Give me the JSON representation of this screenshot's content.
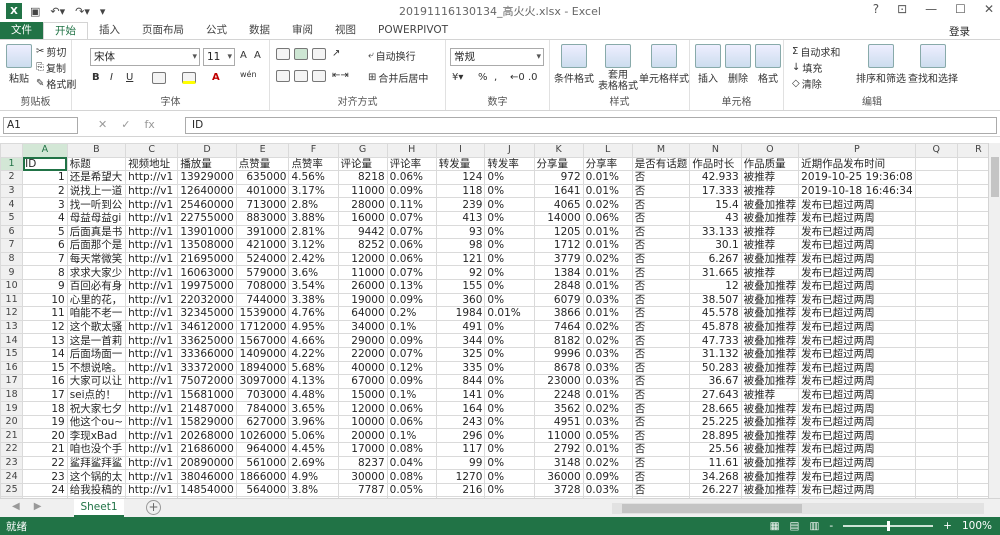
{
  "window": {
    "title": "20191116130134_高火火.xlsx - Excel",
    "app_badge": "X",
    "minimize": "?",
    "restore": "☐",
    "close": "✕",
    "help": "?"
  },
  "tabs": [
    "文件",
    "开始",
    "插入",
    "页面布局",
    "公式",
    "数据",
    "审阅",
    "视图",
    "POWERPIVOT"
  ],
  "login": "登录",
  "ribbon": {
    "clipboard": {
      "label": "剪贴板",
      "paste": "粘贴",
      "cut": "剪切",
      "copy": "复制",
      "format_painter": "格式刷"
    },
    "font": {
      "label": "字体",
      "name": "宋体",
      "size": "11",
      "bold": "B",
      "italic": "I",
      "underline": "U",
      "grow": "A",
      "shrink": "A",
      "wen": "wén"
    },
    "alignment": {
      "label": "对齐方式",
      "wrap": "自动换行",
      "merge": "合并后居中"
    },
    "number": {
      "label": "数字",
      "format": "常规",
      "percent": "%",
      "comma": ","
    },
    "styles": {
      "label": "样式",
      "conditional": "条件格式",
      "table": "套用\n表格格式",
      "cell": "单元格样式"
    },
    "cells": {
      "label": "单元格",
      "insert": "插入",
      "delete": "删除",
      "format": "格式"
    },
    "editing": {
      "label": "编辑",
      "autosum": "自动求和",
      "fill": "填充",
      "clear": "清除",
      "sort": "排序和筛选",
      "find": "查找和选择"
    }
  },
  "formula_bar": {
    "name_box": "A1",
    "fx": "fx",
    "value": "ID"
  },
  "columns": [
    "A",
    "B",
    "C",
    "D",
    "E",
    "F",
    "G",
    "H",
    "I",
    "J",
    "K",
    "L",
    "M",
    "N",
    "O",
    "P",
    "Q",
    "R"
  ],
  "rows": [
    [
      "ID",
      "标题",
      "视频地址",
      "播放量",
      "点赞量",
      "点赞率",
      "评论量",
      "评论率",
      "转发量",
      "转发率",
      "分享量",
      "分享率",
      "是否有话题",
      "作品时长",
      "作品质量",
      "近期作品发布时间",
      "",
      ""
    ],
    [
      "1",
      "还是希望大",
      "http://v1",
      "13929000",
      "635000",
      "4.56%",
      "8218",
      "0.06%",
      "124",
      "0%",
      "972",
      "0.01%",
      "否",
      "42.933",
      "被推荐",
      "2019-10-25 19:36:08",
      "",
      ""
    ],
    [
      "2",
      "说找上一道",
      "http://v1",
      "12640000",
      "401000",
      "3.17%",
      "11000",
      "0.09%",
      "118",
      "0%",
      "1641",
      "0.01%",
      "否",
      "17.333",
      "被推荐",
      "2019-10-18 16:46:34",
      "",
      ""
    ],
    [
      "3",
      "找一听到公",
      "http://v1",
      "25460000",
      "713000",
      "2.8%",
      "28000",
      "0.11%",
      "239",
      "0%",
      "4065",
      "0.02%",
      "否",
      "15.4",
      "被叠加推荐",
      "发布已超过两周",
      "",
      ""
    ],
    [
      "4",
      "母益母益gi",
      "http://v1",
      "22755000",
      "883000",
      "3.88%",
      "16000",
      "0.07%",
      "413",
      "0%",
      "14000",
      "0.06%",
      "否",
      "43",
      "被叠加推荐",
      "发布已超过两周",
      "",
      ""
    ],
    [
      "5",
      "后面真是书",
      "http://v1",
      "13901000",
      "391000",
      "2.81%",
      "9442",
      "0.07%",
      "93",
      "0%",
      "1205",
      "0.01%",
      "否",
      "33.133",
      "被推荐",
      "发布已超过两周",
      "",
      ""
    ],
    [
      "6",
      "后面那个是",
      "http://v1",
      "13508000",
      "421000",
      "3.12%",
      "8252",
      "0.06%",
      "98",
      "0%",
      "1712",
      "0.01%",
      "否",
      "30.1",
      "被推荐",
      "发布已超过两周",
      "",
      ""
    ],
    [
      "7",
      "每天常微笑",
      "http://v1",
      "21695000",
      "524000",
      "2.42%",
      "12000",
      "0.06%",
      "121",
      "0%",
      "3779",
      "0.02%",
      "否",
      "6.267",
      "被叠加推荐",
      "发布已超过两周",
      "",
      ""
    ],
    [
      "8",
      "求求大家少",
      "http://v1",
      "16063000",
      "579000",
      "3.6%",
      "11000",
      "0.07%",
      "92",
      "0%",
      "1384",
      "0.01%",
      "否",
      "31.665",
      "被推荐",
      "发布已超过两周",
      "",
      ""
    ],
    [
      "9",
      "百回必有身",
      "http://v1",
      "19975000",
      "708000",
      "3.54%",
      "26000",
      "0.13%",
      "155",
      "0%",
      "2848",
      "0.01%",
      "否",
      "12",
      "被叠加推荐",
      "发布已超过两周",
      "",
      ""
    ],
    [
      "10",
      "心里的花，",
      "http://v1",
      "22032000",
      "744000",
      "3.38%",
      "19000",
      "0.09%",
      "360",
      "0%",
      "6079",
      "0.03%",
      "否",
      "38.507",
      "被叠加推荐",
      "发布已超过两周",
      "",
      ""
    ],
    [
      "11",
      "咱能不老一",
      "http://v1",
      "32345000",
      "1539000",
      "4.76%",
      "64000",
      "0.2%",
      "1984",
      "0.01%",
      "3866",
      "0.01%",
      "否",
      "45.578",
      "被叠加推荐",
      "发布已超过两周",
      "",
      ""
    ],
    [
      "12",
      "这个歌太骚",
      "http://v1",
      "34612000",
      "1712000",
      "4.95%",
      "34000",
      "0.1%",
      "491",
      "0%",
      "7464",
      "0.02%",
      "否",
      "45.878",
      "被叠加推荐",
      "发布已超过两周",
      "",
      ""
    ],
    [
      "13",
      "这是一首莉",
      "http://v1",
      "33625000",
      "1567000",
      "4.66%",
      "29000",
      "0.09%",
      "344",
      "0%",
      "8182",
      "0.02%",
      "否",
      "47.733",
      "被叠加推荐",
      "发布已超过两周",
      "",
      ""
    ],
    [
      "14",
      "后面场面一",
      "http://v1",
      "33366000",
      "1409000",
      "4.22%",
      "22000",
      "0.07%",
      "325",
      "0%",
      "9996",
      "0.03%",
      "否",
      "31.132",
      "被叠加推荐",
      "发布已超过两周",
      "",
      ""
    ],
    [
      "15",
      "不想说啥。",
      "http://v1",
      "33372000",
      "1894000",
      "5.68%",
      "40000",
      "0.12%",
      "335",
      "0%",
      "8678",
      "0.03%",
      "否",
      "50.283",
      "被叠加推荐",
      "发布已超过两周",
      "",
      ""
    ],
    [
      "16",
      "大家可以让",
      "http://v1",
      "75072000",
      "3097000",
      "4.13%",
      "67000",
      "0.09%",
      "844",
      "0%",
      "23000",
      "0.03%",
      "否",
      "36.67",
      "被叠加推荐",
      "发布已超过两周",
      "",
      ""
    ],
    [
      "17",
      "sei点的！",
      "http://v1",
      "15681000",
      "703000",
      "4.48%",
      "15000",
      "0.1%",
      "141",
      "0%",
      "2248",
      "0.01%",
      "否",
      "27.643",
      "被推荐",
      "发布已超过两周",
      "",
      ""
    ],
    [
      "18",
      "祝大家七夕",
      "http://v1",
      "21487000",
      "784000",
      "3.65%",
      "12000",
      "0.06%",
      "164",
      "0%",
      "3562",
      "0.02%",
      "否",
      "28.665",
      "被叠加推荐",
      "发布已超过两周",
      "",
      ""
    ],
    [
      "19",
      "他这个ou~",
      "http://v1",
      "15829000",
      "627000",
      "3.96%",
      "10000",
      "0.06%",
      "243",
      "0%",
      "4951",
      "0.03%",
      "否",
      "25.225",
      "被叠加推荐",
      "发布已超过两周",
      "",
      ""
    ],
    [
      "20",
      "李现xBad",
      "http://v1",
      "20268000",
      "1026000",
      "5.06%",
      "20000",
      "0.1%",
      "296",
      "0%",
      "11000",
      "0.05%",
      "否",
      "28.895",
      "被叠加推荐",
      "发布已超过两周",
      "",
      ""
    ],
    [
      "21",
      "咱也没个手",
      "http://v1",
      "21686000",
      "964000",
      "4.45%",
      "17000",
      "0.08%",
      "117",
      "0%",
      "2792",
      "0.01%",
      "否",
      "25.56",
      "被叠加推荐",
      "发布已超过两周",
      "",
      ""
    ],
    [
      "22",
      "鲨拜鲨拜鲨",
      "http://v1",
      "20890000",
      "561000",
      "2.69%",
      "8237",
      "0.04%",
      "99",
      "0%",
      "3148",
      "0.02%",
      "否",
      "11.61",
      "被叠加推荐",
      "发布已超过两周",
      "",
      ""
    ],
    [
      "23",
      "这个锅的太",
      "http://v1",
      "38046000",
      "1866000",
      "4.9%",
      "30000",
      "0.08%",
      "1270",
      "0%",
      "36000",
      "0.09%",
      "否",
      "34.268",
      "被叠加推荐",
      "发布已超过两周",
      "",
      ""
    ],
    [
      "24",
      "给我投稿的",
      "http://v1",
      "14854000",
      "564000",
      "3.8%",
      "7787",
      "0.05%",
      "216",
      "0%",
      "3728",
      "0.03%",
      "否",
      "26.227",
      "被叠加推荐",
      "发布已超过两周",
      "",
      ""
    ],
    [
      "25",
      "新单曲。齐",
      "http://v1",
      "11821000",
      "356000",
      "3.01%",
      "8101",
      "0.07%",
      "275",
      "0%",
      "2116",
      "0.02%",
      "否",
      "56.967",
      "被推荐",
      "发布已超过两周",
      "",
      ""
    ]
  ],
  "sheet": {
    "name": "Sheet1",
    "add": "+"
  },
  "status": {
    "ready": "就绪",
    "zoom": "100%",
    "minus": "-",
    "plus": "+"
  }
}
